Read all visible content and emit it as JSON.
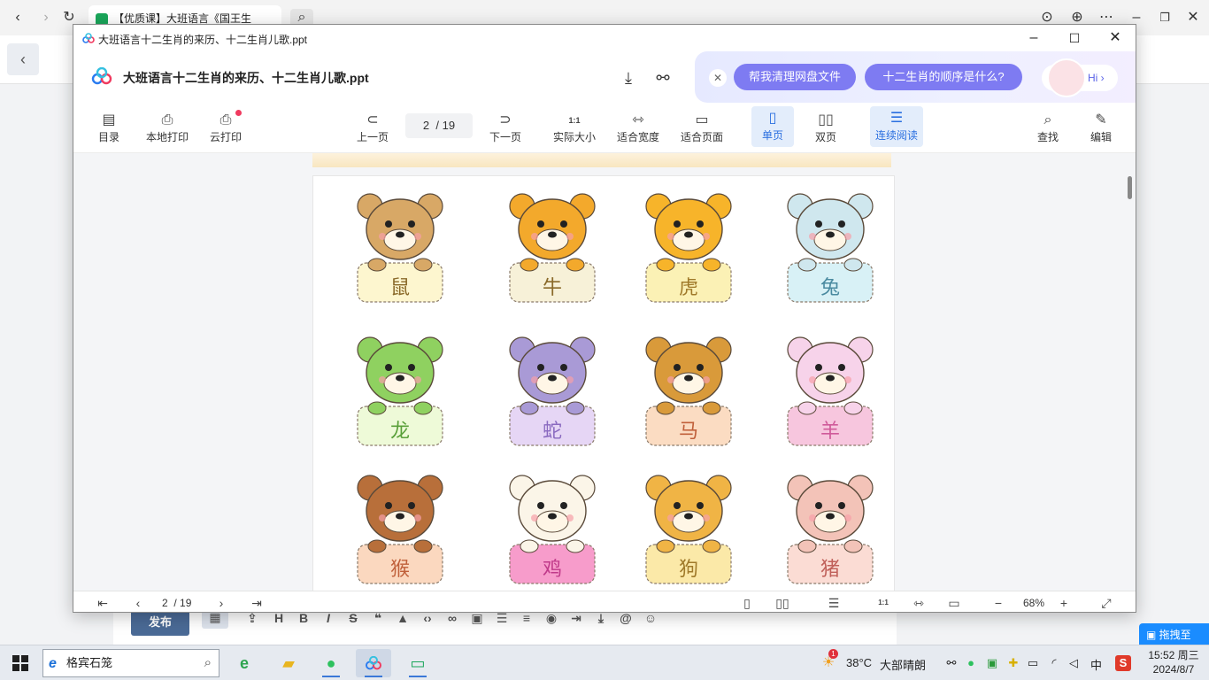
{
  "browser": {
    "tab_title": "【优质课】大班语言《国王生",
    "nav_icons": [
      "back-icon",
      "forward-icon",
      "reload-icon",
      "search-icon"
    ],
    "right_icons": [
      "download-icon",
      "globe-icon",
      "more-icon",
      "restore-icon",
      "close-icon"
    ]
  },
  "editor": {
    "publish_label": "发布",
    "toolbar_icons": [
      "image-icon",
      "file-up-icon",
      "heading-icon",
      "bold-icon",
      "italic-icon",
      "strikethrough-icon",
      "quote-icon",
      "warning-icon",
      "code-icon",
      "link-icon",
      "picture-icon",
      "bullet-list-icon",
      "numbered-list-icon",
      "comment-icon",
      "indent-icon",
      "download-icon",
      "mention-icon",
      "emoji-icon"
    ],
    "heading_glyph": "H",
    "bold_glyph": "B",
    "italic_glyph": "I",
    "strike_glyph": "S",
    "mention_glyph": "@"
  },
  "drag_widget_label": "拖拽至",
  "viewer": {
    "window_title": "大班语言十二生肖的来历、十二生肖儿歌.ppt",
    "doc_title": "大班语言十二生肖的来历、十二生肖儿歌.ppt",
    "ai_chips": [
      "帮我清理网盘文件",
      "十二生肖的顺序是什么?"
    ],
    "ai_hi": "Hi",
    "toolbar": {
      "toc": "目录",
      "local_print": "本地打印",
      "cloud_print": "云打印",
      "prev_page": "上一页",
      "page_current": "2",
      "page_total": "/ 19",
      "next_page": "下一页",
      "actual_size": "实际大小",
      "fit_width": "适合宽度",
      "fit_page": "适合页面",
      "single_page": "单页",
      "double_page": "双页",
      "continuous": "连续阅读",
      "find": "查找",
      "edit": "编辑",
      "actual_size_glyph": "1:1"
    },
    "bottom": {
      "page_current": "2",
      "page_total": "/ 19",
      "zoom": "68%",
      "ratio_glyph": "1:1",
      "minus": "−",
      "plus": "+"
    }
  },
  "zodiac": [
    {
      "label": "鼠",
      "body": "#d8a866",
      "plate": "#fdf6cf",
      "text_color": "#8a6a2a"
    },
    {
      "label": "牛",
      "body": "#f3a92c",
      "plate": "#f7f1d8",
      "text_color": "#8a6a2a"
    },
    {
      "label": "虎",
      "body": "#f7b42a",
      "plate": "#fbf1b5",
      "text_color": "#a07a2a"
    },
    {
      "label": "兔",
      "body": "#cfe7ee",
      "plate": "#d8f1f6",
      "text_color": "#4a8aa0"
    },
    {
      "label": "龙",
      "body": "#8fd160",
      "plate": "#eefad8",
      "text_color": "#5aa03a"
    },
    {
      "label": "蛇",
      "body": "#a99ad6",
      "plate": "#e6d6f5",
      "text_color": "#8a6ac0"
    },
    {
      "label": "马",
      "body": "#d99a3a",
      "plate": "#fbdcc2",
      "text_color": "#c0603a"
    },
    {
      "label": "羊",
      "body": "#f7d3ea",
      "plate": "#f7c6de",
      "text_color": "#d05a9a"
    },
    {
      "label": "猴",
      "body": "#b86f3a",
      "plate": "#fbd8bf",
      "text_color": "#c0603a"
    },
    {
      "label": "鸡",
      "body": "#fbf5e8",
      "plate": "#f79ccb",
      "text_color": "#c03a8a"
    },
    {
      "label": "狗",
      "body": "#f0b445",
      "plate": "#fbe9a8",
      "text_color": "#a07a2a"
    },
    {
      "label": "猪",
      "body": "#f3c3b8",
      "plate": "#fbdcd4",
      "text_color": "#c0605a"
    }
  ],
  "taskbar": {
    "search_text": "格宾石笼",
    "apps": [
      "ie-icon",
      "folder-icon",
      "wechat-icon",
      "baidu-netdisk-icon",
      "screen-icon"
    ],
    "weather_temp": "38°C",
    "weather_text": "大部晴朗",
    "ime": "中",
    "time": "15:52 周三",
    "date": "2024/8/7",
    "notification_count": "1"
  }
}
